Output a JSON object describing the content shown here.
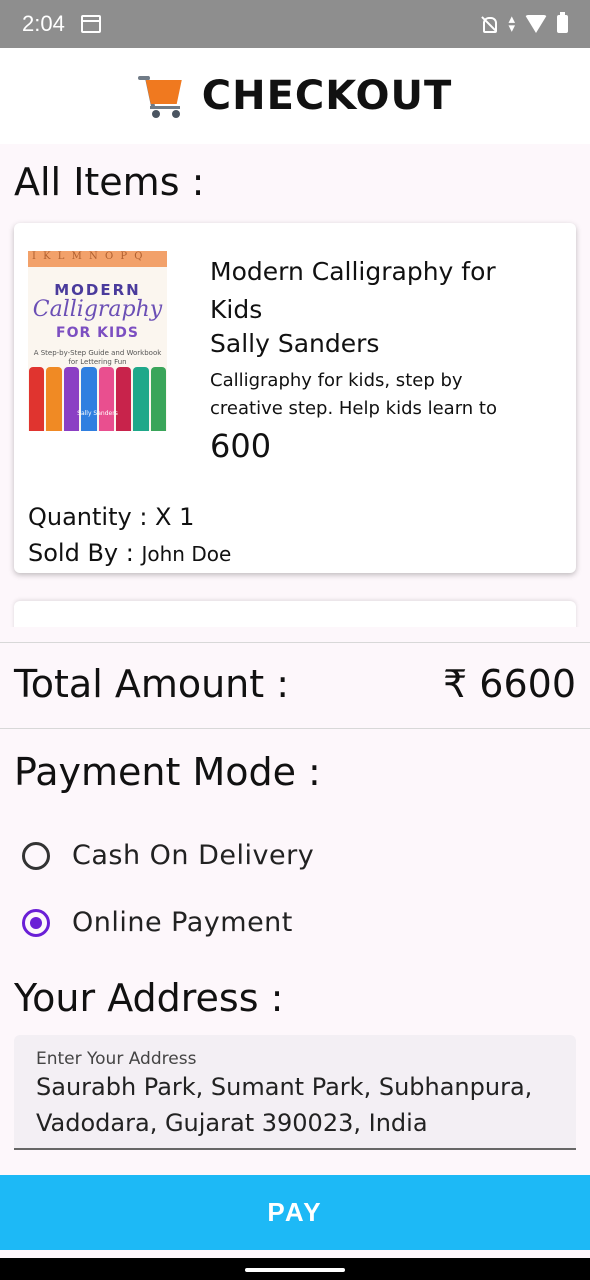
{
  "status_bar": {
    "time": "2:04"
  },
  "header": {
    "title": "CHECKOUT",
    "icon": "shopping-cart-icon"
  },
  "all_items_heading": "All Items :",
  "items": [
    {
      "title": "Modern Calligraphy for Kids",
      "author": "Sally Sanders",
      "description": "Calligraphy for kids, step by creative step. Help kids learn to",
      "price": "600",
      "quantity_label": "Quantity : X 1",
      "sold_by_label": "Sold By :",
      "seller": "John Doe",
      "cover": {
        "top_letters": "I K L M N O P Q",
        "line1": "MODERN",
        "line2": "Calligraphy",
        "line3": "FOR KIDS",
        "subtitle": "A Step-by-Step Guide and Workbook for Lettering Fun",
        "author": "Sally Sanders"
      }
    }
  ],
  "total": {
    "label": "Total Amount :",
    "value": "₹ 6600"
  },
  "payment_mode": {
    "heading": "Payment Mode :",
    "options": [
      {
        "label": "Cash On Delivery",
        "selected": false
      },
      {
        "label": "Online Payment",
        "selected": true
      }
    ]
  },
  "address": {
    "heading": "Your Address :",
    "label": "Enter Your Address",
    "value": "Saurabh Park, Sumant Park, Subhanpura, Vadodara, Gujarat 390023, India"
  },
  "pay_button": "PAY",
  "colors": {
    "accent": "#6a1fd6",
    "pay": "#1db9f6",
    "cart": "#f0791f"
  }
}
